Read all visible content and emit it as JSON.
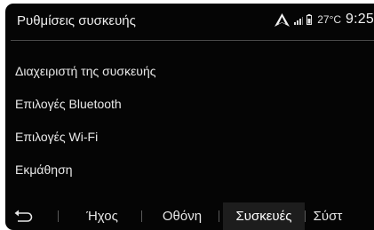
{
  "header": {
    "title": "Ρυθμίσεις συσκευής",
    "temperature": "27°C",
    "clock": "9:25"
  },
  "icons": {
    "navigation": "navigation-arrow-icon",
    "signal": "signal-strength-icon",
    "battery": "battery-icon",
    "back": "back-arrow-icon"
  },
  "menu": {
    "items": [
      {
        "label": "Διαχειριστή της συσκευής"
      },
      {
        "label": "Επιλογές Bluetooth"
      },
      {
        "label": "Επιλογές Wi-Fi"
      },
      {
        "label": "Εκμάθηση"
      }
    ]
  },
  "bottom_tabs": [
    {
      "label": "Ήχος",
      "active": false
    },
    {
      "label": "Οθόνη",
      "active": false
    },
    {
      "label": "Συσκευές",
      "active": true
    },
    {
      "label": "Σύστ",
      "active": false
    }
  ],
  "colors": {
    "background": "#050505",
    "text": "#eaeaea",
    "active_tab": "#1d1d1d"
  }
}
